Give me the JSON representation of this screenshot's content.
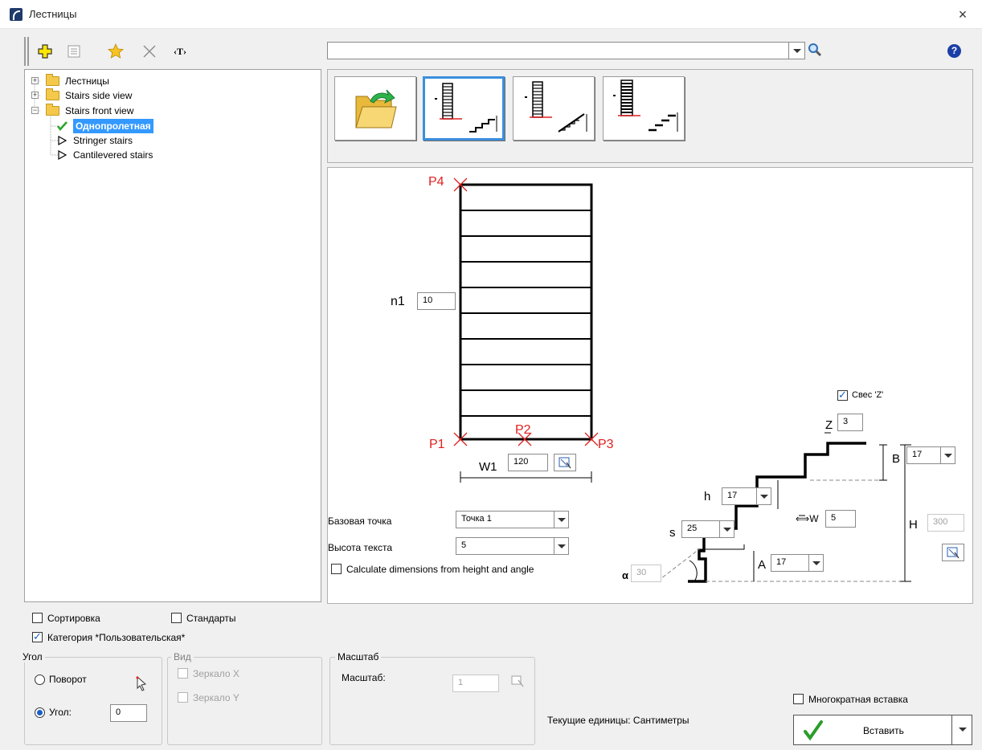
{
  "window": {
    "title": "Лестницы",
    "close": "×"
  },
  "toolbar": {
    "text_tool": "‹T›",
    "search_value": "",
    "help": "?"
  },
  "tree": {
    "nodes": [
      {
        "label": "Лестницы"
      },
      {
        "label": "Stairs side view"
      },
      {
        "label": "Stairs front view"
      },
      {
        "label": "Однопролетная"
      },
      {
        "label": "Stringer stairs"
      },
      {
        "label": "Cantilevered stairs"
      }
    ]
  },
  "drawing": {
    "points": {
      "p1": "P1",
      "p2": "P2",
      "p3": "P3",
      "p4": "P4"
    },
    "n1_label": "n1",
    "n1_value": "10",
    "w1_label": "W1",
    "w1_value": "120",
    "base_point_label": "Базовая точка",
    "base_point_value": "Точка 1",
    "text_height_label": "Высота текста",
    "text_height_value": "5",
    "calc_label": "Calculate dimensions from height and angle",
    "overhang_label": "Свес 'Z'",
    "z_label": "Z",
    "z_value": "3",
    "b_label": "B",
    "b_value": "17",
    "h_small_label": "h",
    "h_small_value": "17",
    "w_label": "W",
    "w_value": "5",
    "s_label": "s",
    "s_value": "25",
    "a_label": "A",
    "a_value": "17",
    "alpha_label": "α",
    "alpha_value": "30",
    "H_label": "H",
    "H_value": "300"
  },
  "options": {
    "sort_label": "Сортировка",
    "standards_label": "Стандарты",
    "category_label": "Категория *Пользовательская*"
  },
  "angle_group": {
    "title": "Угол",
    "rotate_label": "Поворот",
    "angle_label": "Угол:",
    "angle_value": "0"
  },
  "view_group": {
    "title": "Вид",
    "mirror_x": "Зеркало X",
    "mirror_y": "Зеркало Y"
  },
  "scale_group": {
    "title": "Масштаб",
    "scale_label": "Масштаб:",
    "scale_value": "1"
  },
  "status": {
    "units": "Текущие единицы: Сантиметры"
  },
  "insert": {
    "multiple_label": "Многократная вставка",
    "button_label": "Вставить"
  },
  "colors": {
    "accent": "#3399ff",
    "point_marker": "#e02020",
    "thumb_selected": "#3c8edc"
  }
}
